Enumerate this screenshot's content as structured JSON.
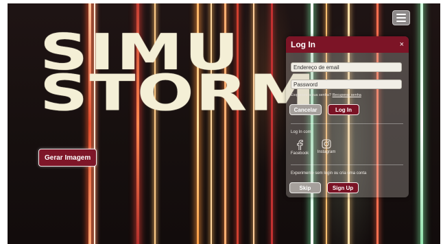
{
  "hero": {
    "title_line1": "SIMU",
    "title_line2": "STORM",
    "cta_label": "Gerar Imagem"
  },
  "nav": {
    "menu_icon": "hamburger-icon"
  },
  "login": {
    "title": "Log In",
    "close_label": "×",
    "email_placeholder": "Endereço de email",
    "password_placeholder": "Password",
    "forgot_text": "Esqueceu a sua senha?",
    "recover_link": "Recuperar senha",
    "cancel_label": "Cancelar",
    "submit_label": "Log In",
    "social_heading": "Log In com",
    "facebook_label": "Facebook",
    "instagram_label": "Instagram",
    "guest_text": "Experimente sem login ou cria uma conta",
    "skip_label": "Skip",
    "signup_label": "Sign Up"
  },
  "colors": {
    "accent": "#7c1426",
    "hero_text": "#f4efd6",
    "modal_glass": "rgba(195,190,185,0.32)"
  }
}
